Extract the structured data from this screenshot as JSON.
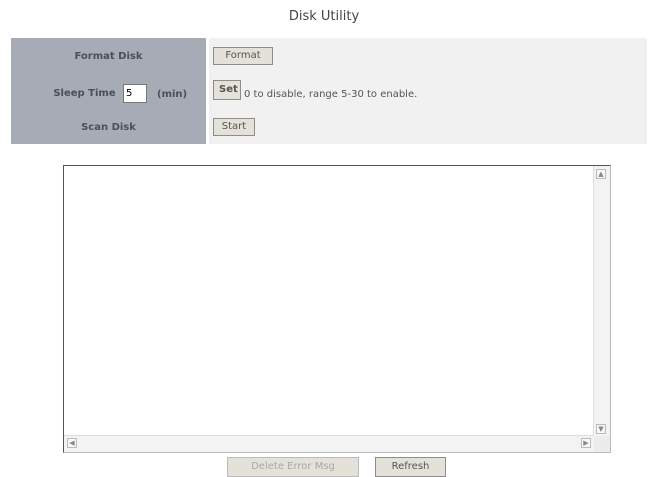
{
  "page": {
    "title": "Disk Utility"
  },
  "format": {
    "label": "Format Disk",
    "button": "Format"
  },
  "sleep": {
    "label": "Sleep Time",
    "value": "5",
    "unit": "(min)",
    "button": "Set",
    "hint": "0 to disable, range 5-30 to enable."
  },
  "scan": {
    "label": "Scan Disk",
    "button": "Start"
  },
  "log": {
    "text": ""
  },
  "actions": {
    "delete_label": "Delete Error Msg",
    "refresh_label": "Refresh"
  },
  "colors": {
    "label_bg": "#a6abb5",
    "value_bg": "#f1f1f1",
    "button_bg": "#e4e1d8"
  }
}
